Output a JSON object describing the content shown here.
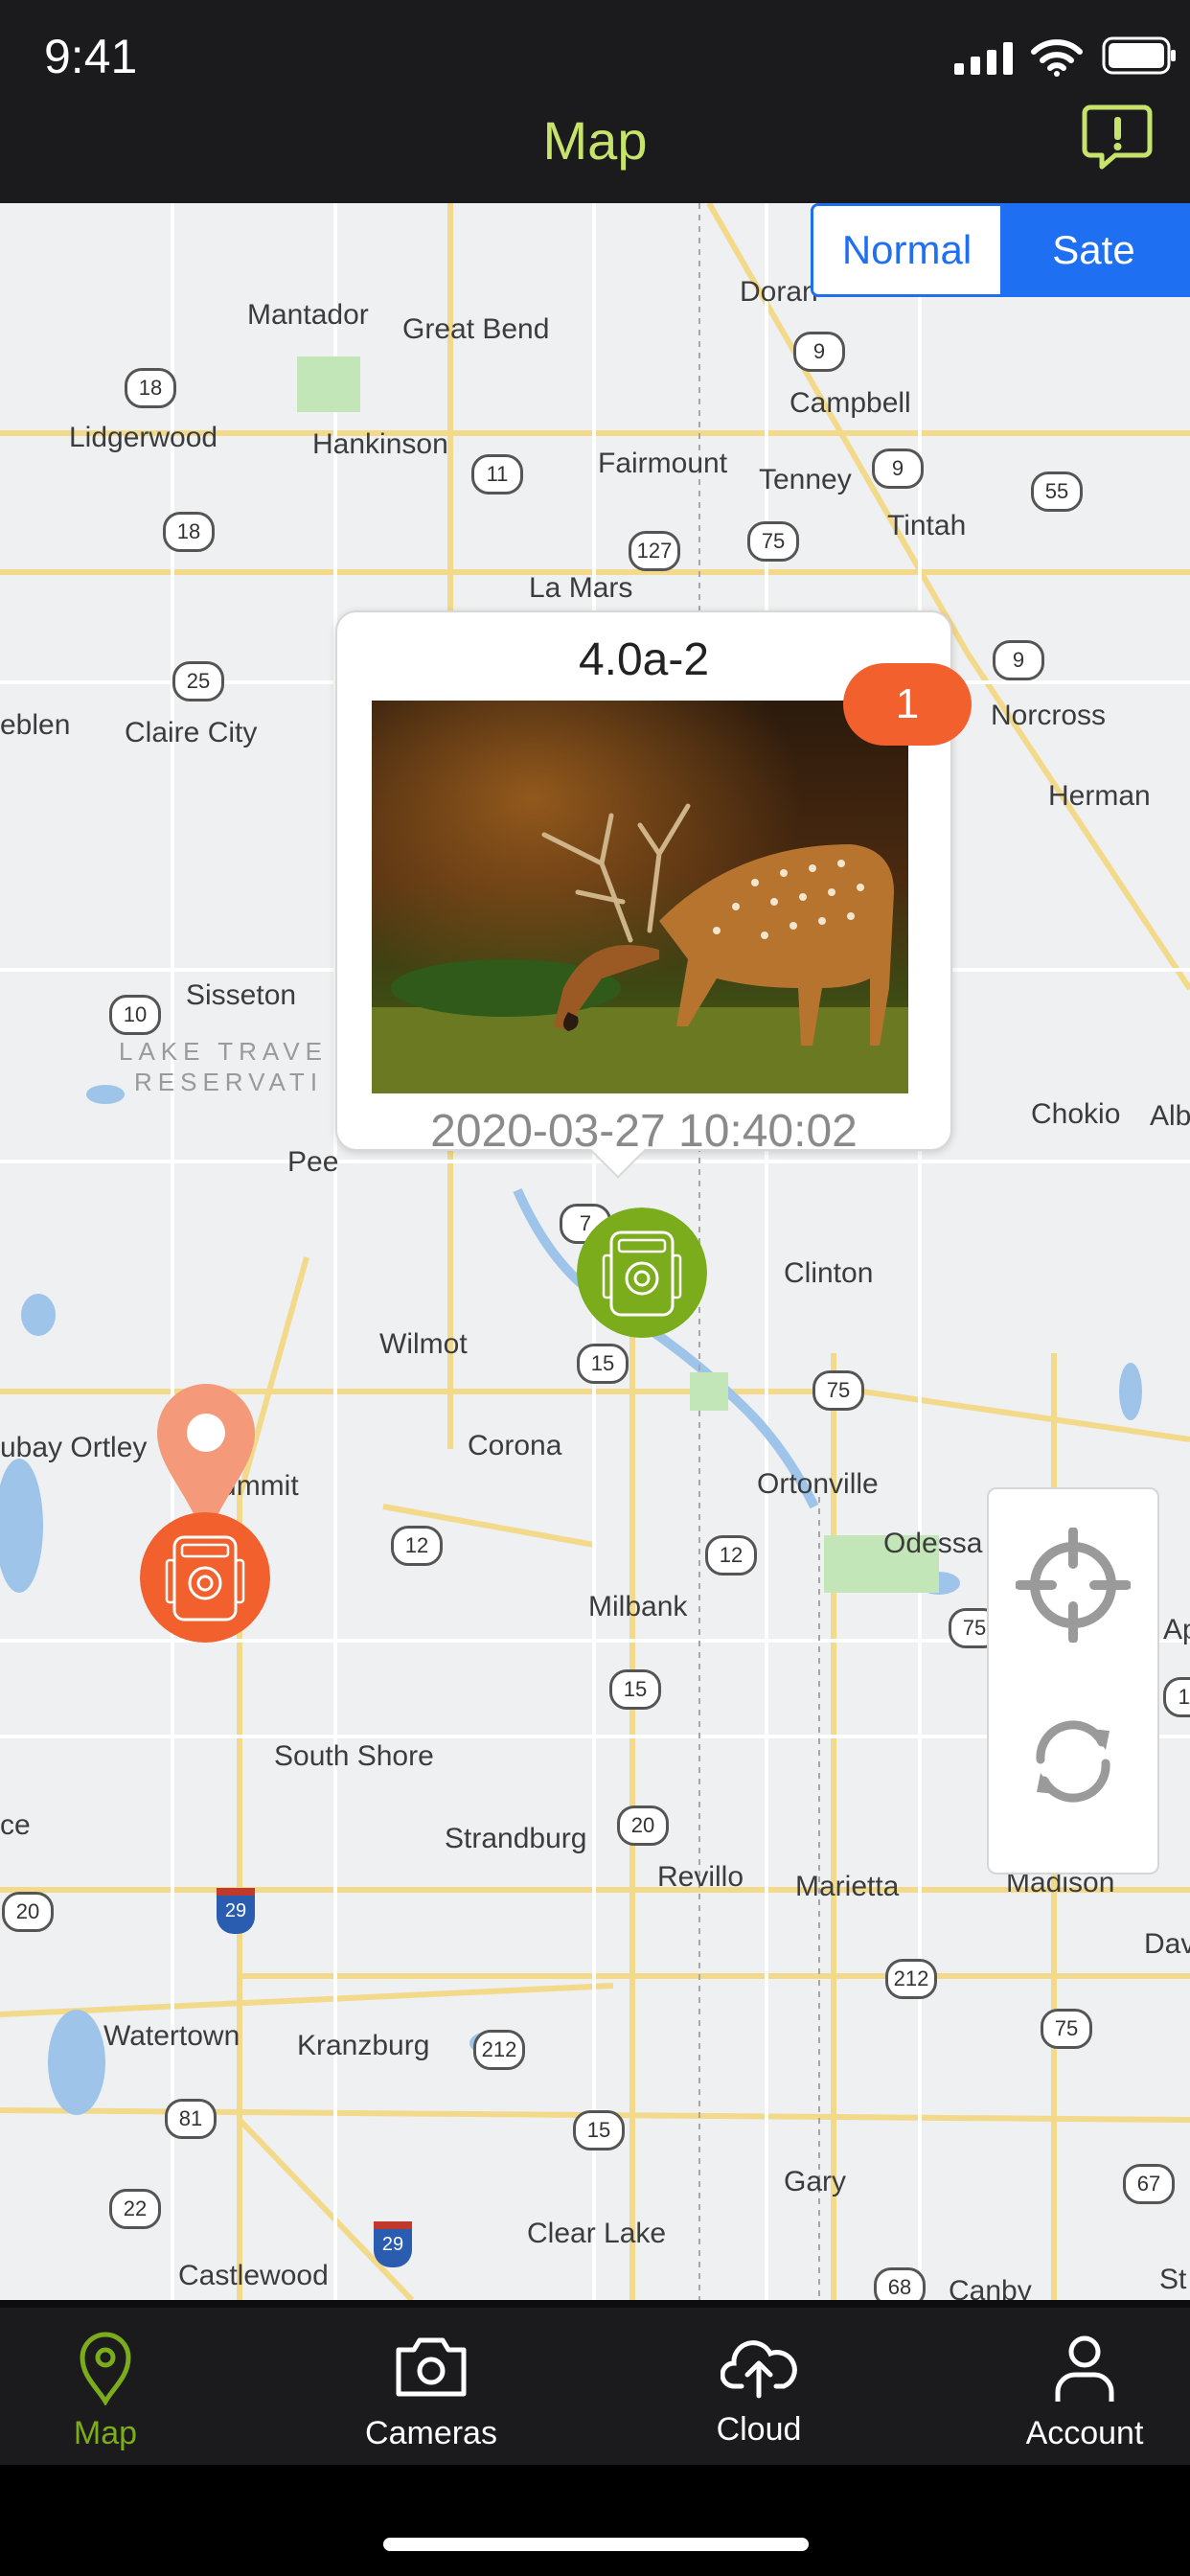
{
  "status_bar": {
    "time": "9:41"
  },
  "header": {
    "title": "Map",
    "title_color": "#c7e36b",
    "alert_icon": "alert-bubble-icon"
  },
  "map_type": {
    "normal_label": "Normal",
    "satellite_label": "Sate",
    "selected": "satellite",
    "accent": "#1f6ff2"
  },
  "places": {
    "mantador": "Mantador",
    "great_bend": "Great Bend",
    "doran": "Doran",
    "campbell": "Campbell",
    "lidgerwood": "Lidgerwood",
    "hankinson": "Hankinson",
    "fairmount": "Fairmount",
    "tenney": "Tenney",
    "tintah": "Tintah",
    "la_mars": "La Mars",
    "eblen": "eblen",
    "claire_city": "Claire City",
    "norcross": "Norcross",
    "herman": "Herman",
    "sisseton": "Sisseton",
    "lake_traverse_1": "LAKE TRAVE",
    "lake_traverse_2": "RESERVATI",
    "pee": "Pee",
    "chokio": "Chokio",
    "alb": "Alb",
    "wilmot": "Wilmot",
    "clinton": "Clinton",
    "corona": "Corona",
    "ortley": "ubay Ortley",
    "summit": "Summit",
    "ortonville": "Ortonville",
    "odessa": "Odessa",
    "ap": "Ap",
    "milbank": "Milbank",
    "south_shore": "South Shore",
    "ce": "ce",
    "strandburg": "Strandburg",
    "revillo": "Revillo",
    "marietta": "Marietta",
    "madison": "Madison",
    "dav": "Dav",
    "watertown": "Watertown",
    "kranzburg": "Kranzburg",
    "gary": "Gary",
    "clear_lake": "Clear Lake",
    "castlewood": "Castlewood",
    "canby": "Canby",
    "st": "St"
  },
  "route_shields": {
    "r18a": "18",
    "r18b": "18",
    "r9a": "9",
    "r9b": "9",
    "r9c": "9",
    "r11": "11",
    "r55": "55",
    "r127": "127",
    "r75a": "75",
    "r25": "25",
    "r10": "10",
    "r7": "7",
    "r15a": "15",
    "r75b": "75",
    "r12a": "12",
    "r12b": "12",
    "r75c": "75",
    "r15b": "15",
    "r20a": "20",
    "r20b": "20",
    "r212a": "212",
    "r75d": "75",
    "r212b": "212",
    "r81": "81",
    "r15c": "15",
    "r22": "22",
    "r67": "67",
    "r68": "68",
    "r11b": "11"
  },
  "interstates": {
    "i29a": "29",
    "i29b": "29"
  },
  "popup": {
    "camera_name": "4.0a-2",
    "timestamp": "2020-03-27 10:40:02",
    "photo_count": "1",
    "badge_color": "#f2602e"
  },
  "markers": {
    "selected_camera_color": "#7aac1c",
    "other_camera_color": "#f2602e"
  },
  "map_controls": {
    "locate_icon": "crosshair-icon",
    "refresh_icon": "refresh-icon"
  },
  "tabs": [
    {
      "label": "Map",
      "icon": "map-pin-icon",
      "active": true
    },
    {
      "label": "Cameras",
      "icon": "camera-icon",
      "active": false
    },
    {
      "label": "Cloud",
      "icon": "cloud-upload-icon",
      "active": false
    },
    {
      "label": "Account",
      "icon": "person-icon",
      "active": false
    }
  ],
  "tab_active_color": "#7aac1c"
}
